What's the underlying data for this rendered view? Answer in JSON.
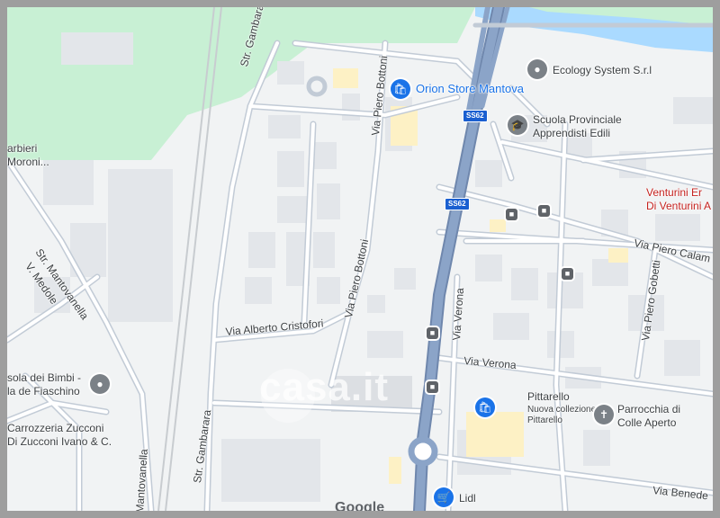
{
  "pois": {
    "orion": {
      "name": "Orion Store Mantova",
      "icon": "shopping-bag-icon"
    },
    "ecology": {
      "name": "Ecology System S.r.l",
      "icon": "map-pin-icon"
    },
    "scuola": {
      "name_1": "Scuola Provinciale",
      "name_2": "Apprendisti Edili",
      "icon": "school-icon"
    },
    "venturini": {
      "name_1": "Venturini Er",
      "name_2": "Di Venturini A"
    },
    "barbieri": {
      "name_1": "arbieri",
      "name_2": "Moroni..."
    },
    "bimbi": {
      "name_1": "sola dei Bimbi -",
      "name_2": "la de Fiaschino",
      "icon": "map-pin-icon"
    },
    "carrozzeria": {
      "name_1": "Carrozzeria Zucconi",
      "name_2": "Di Zucconi Ivano & C."
    },
    "pittarello": {
      "name": "Pittarello",
      "sub_1": "Nuova collezione",
      "sub_2": "Pittarello",
      "icon": "shopping-bag-icon"
    },
    "parrocchia": {
      "name_1": "Parrocchia di",
      "name_2": "Colle Aperto",
      "icon": "church-cross-icon"
    },
    "lidl": {
      "name": "Lidl",
      "icon": "shopping-cart-icon"
    }
  },
  "roads": {
    "gambarara_top": "Str. Gambarara",
    "gambarara_bottom": "Str. Gambarara",
    "bottoni_top": "Via Piero Bottoni",
    "bottoni_mid": "Via Piero Bottoni",
    "cristofori": "Via Alberto Cristofori",
    "mantovanella": "Str. Mantovanella",
    "mantovanella_bottom": "Mantovanella",
    "medole": "V. Medole",
    "verona_vertical": "Via Verona",
    "verona": "Via Verona",
    "calamandrei": "Via Piero Calam",
    "gobetti": "Via Piero Gobetti",
    "benedetto": "Via Benede"
  },
  "shields": {
    "ss62_top": "SS62",
    "ss62_mid": "SS62"
  },
  "bus_icon": "bus-stop-icon",
  "watermark": "casa.it",
  "attribution": "Google",
  "colors": {
    "water": "#aadaff",
    "park": "#c8f0d4",
    "highway": "#8ba4c8",
    "road": "#ffffff",
    "building": "#e3e6ea",
    "poi_blue": "#1a73e8"
  }
}
